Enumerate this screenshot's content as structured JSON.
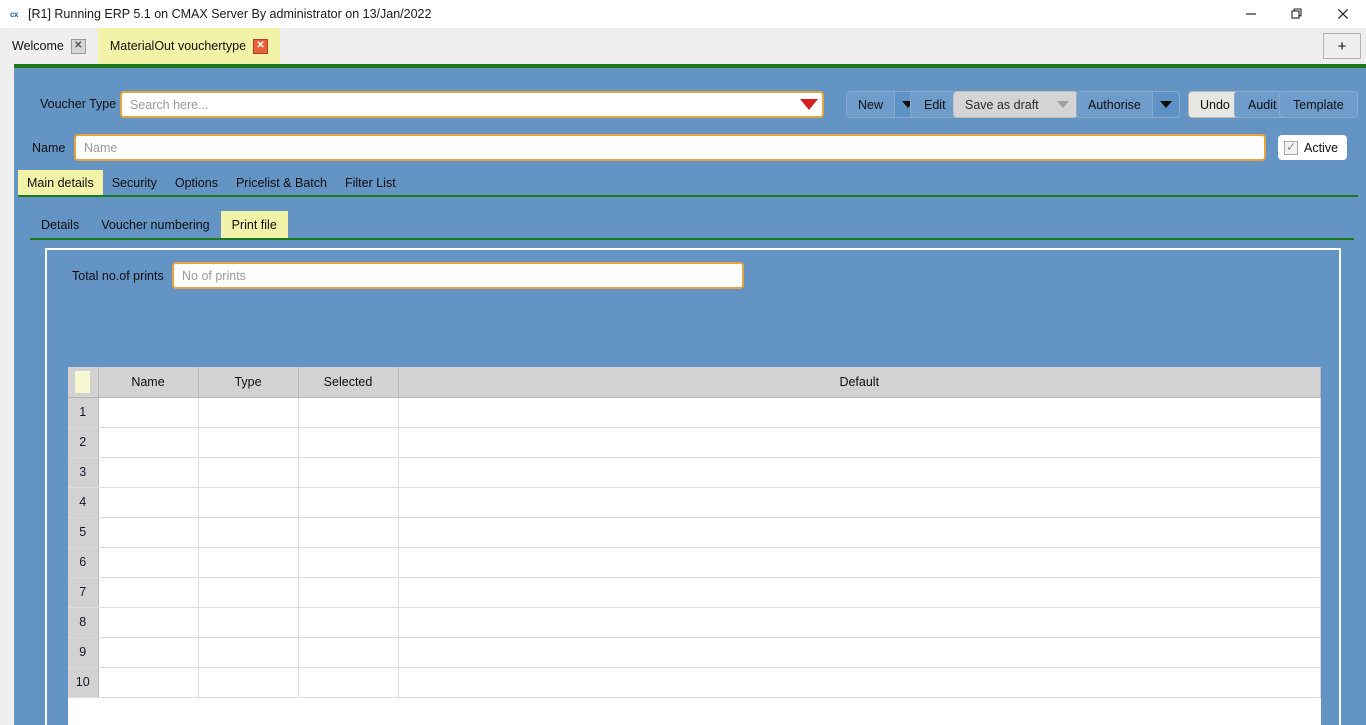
{
  "window": {
    "title": "[R1] Running ERP 5.1 on CMAX Server By administrator on 13/Jan/2022",
    "app_icon": "cx",
    "minimize_glyph": "minimize-icon",
    "restore_glyph": "restore-icon",
    "close_glyph": "close-icon"
  },
  "doc_tabs": {
    "items": [
      {
        "label": "Welcome",
        "active": false,
        "close": "✕"
      },
      {
        "label": "MaterialOut vouchertype",
        "active": true,
        "close": "✕"
      }
    ],
    "new_tab_label": "+"
  },
  "form": {
    "voucher_type_label": "Voucher Type",
    "search_placeholder": "Search here...",
    "search_value": "",
    "name_label": "Name",
    "name_placeholder": "Name",
    "name_value": "",
    "active_label": "Active",
    "active_checked": true,
    "active_check_glyph": "✓"
  },
  "toolbar": {
    "new_label": "New",
    "edit_label": "Edit",
    "save_as_draft_label": "Save as draft",
    "authorise_label": "Authorise",
    "undo_label": "Undo",
    "audit_label": "Audit",
    "template_label": "Template"
  },
  "main_tabs": [
    {
      "label": "Main details",
      "active": true
    },
    {
      "label": "Security",
      "active": false
    },
    {
      "label": "Options",
      "active": false
    },
    {
      "label": "Pricelist & Batch",
      "active": false
    },
    {
      "label": "Filter List",
      "active": false
    }
  ],
  "sub_tabs": [
    {
      "label": "Details",
      "active": false
    },
    {
      "label": "Voucher numbering",
      "active": false
    },
    {
      "label": "Print file",
      "active": true
    }
  ],
  "print_file": {
    "total_prints_label": "Total no.of prints",
    "total_prints_placeholder": "No of prints",
    "total_prints_value": "",
    "grid": {
      "columns": [
        "",
        "Name",
        "Type",
        "Selected",
        "Default"
      ],
      "rows": [
        {
          "n": "1",
          "name": "",
          "type": "",
          "selected": "",
          "default": ""
        },
        {
          "n": "2",
          "name": "",
          "type": "",
          "selected": "",
          "default": ""
        },
        {
          "n": "3",
          "name": "",
          "type": "",
          "selected": "",
          "default": ""
        },
        {
          "n": "4",
          "name": "",
          "type": "",
          "selected": "",
          "default": ""
        },
        {
          "n": "5",
          "name": "",
          "type": "",
          "selected": "",
          "default": ""
        },
        {
          "n": "6",
          "name": "",
          "type": "",
          "selected": "",
          "default": ""
        },
        {
          "n": "7",
          "name": "",
          "type": "",
          "selected": "",
          "default": ""
        },
        {
          "n": "8",
          "name": "",
          "type": "",
          "selected": "",
          "default": ""
        },
        {
          "n": "9",
          "name": "",
          "type": "",
          "selected": "",
          "default": ""
        },
        {
          "n": "10",
          "name": "",
          "type": "",
          "selected": "",
          "default": ""
        }
      ]
    }
  },
  "colors": {
    "content_blue": "#6494c4",
    "accent_green": "#1a7a1a",
    "active_tab_yellow": "#f2f2a8",
    "field_border_orange": "#e8a33d",
    "dropdown_red": "#d32020",
    "button_blue": "#6e9ccb",
    "header_gray": "#d2d2d2"
  }
}
